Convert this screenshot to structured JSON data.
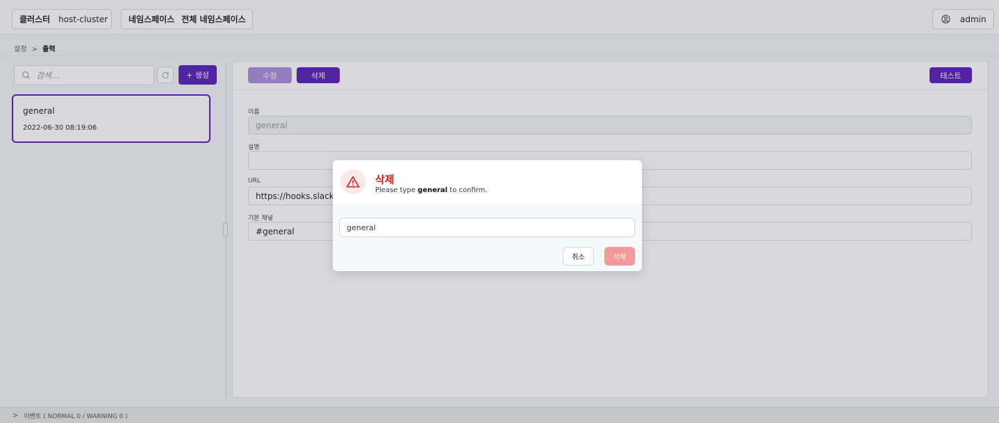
{
  "header": {
    "cluster_label": "클러스터",
    "cluster_value": "host-cluster",
    "namespace_label": "네임스페이스",
    "namespace_value": "전체 네임스페이스",
    "user": "admin"
  },
  "breadcrumb": {
    "parent": "설정",
    "separator": ">",
    "current": "출력"
  },
  "sidebar": {
    "search_placeholder": "검색...",
    "create_label": "+ 생성",
    "items": [
      {
        "name": "general",
        "date": "2022-06-30 08:19:06"
      }
    ]
  },
  "toolbar": {
    "edit_label": "수정",
    "delete_label": "삭제",
    "test_label": "테스트"
  },
  "form": {
    "name_label": "이름",
    "name_value": "general",
    "description_label": "설명",
    "description_value": "",
    "url_label": "URL",
    "url_value": "https://hooks.slack.com",
    "channel_label": "기본 채널",
    "channel_value": "#general"
  },
  "events": {
    "label": "이벤트 ( NORMAL 0 / WARNING 0 )"
  },
  "modal": {
    "title": "삭제",
    "desc_prefix": "Please type ",
    "desc_target": "general",
    "desc_suffix": " to confirm.",
    "input_value": "general",
    "cancel_label": "취소",
    "confirm_label": "삭제"
  },
  "colors": {
    "accent": "#5b21b6",
    "danger": "#c81e1e",
    "danger_button": "#f29a9a"
  }
}
